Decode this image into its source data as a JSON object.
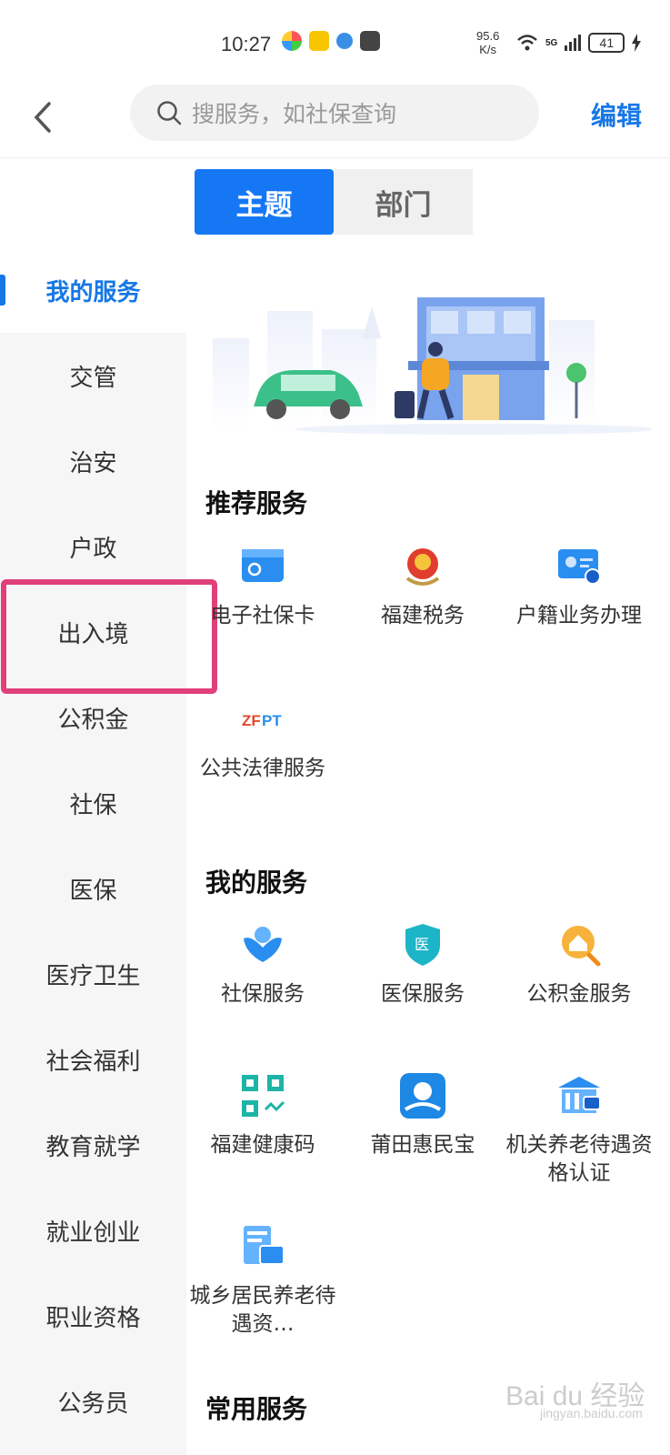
{
  "status_bar": {
    "time": "10:27",
    "net_speed_top": "95.6",
    "net_speed_bottom": "K/s",
    "network": "5G",
    "battery": "41"
  },
  "header": {
    "search_placeholder": "搜服务，如社保查询",
    "edit_label": "编辑"
  },
  "tabs": [
    {
      "label": "主题"
    },
    {
      "label": "部门"
    }
  ],
  "sidebar": {
    "items": [
      {
        "label": "我的服务"
      },
      {
        "label": "交管"
      },
      {
        "label": "治安"
      },
      {
        "label": "户政"
      },
      {
        "label": "出入境"
      },
      {
        "label": "公积金"
      },
      {
        "label": "社保"
      },
      {
        "label": "医保"
      },
      {
        "label": "医疗卫生"
      },
      {
        "label": "社会福利"
      },
      {
        "label": "教育就学"
      },
      {
        "label": "就业创业"
      },
      {
        "label": "职业资格"
      },
      {
        "label": "公务员"
      }
    ]
  },
  "recommended": {
    "title": "推荐服务",
    "items": [
      {
        "label": "电子社保卡",
        "icon": "social-security-card-icon"
      },
      {
        "label": "福建税务",
        "icon": "tax-emblem-icon"
      },
      {
        "label": "户籍业务办理",
        "icon": "household-registration-icon"
      },
      {
        "label": "公共法律服务",
        "icon": "zfpt-legal-service-icon"
      }
    ]
  },
  "my_services": {
    "title": "我的服务",
    "items": [
      {
        "label": "社保服务",
        "icon": "social-security-hands-icon"
      },
      {
        "label": "医保服务",
        "icon": "medical-insurance-shield-icon"
      },
      {
        "label": "公积金服务",
        "icon": "housing-fund-icon"
      },
      {
        "label": "福建健康码",
        "icon": "health-code-icon"
      },
      {
        "label": "莆田惠民宝",
        "icon": "putian-huiminbao-icon"
      },
      {
        "label": "机关养老待遇资格认证",
        "icon": "pension-building-icon"
      },
      {
        "label": "城乡居民养老待遇资…",
        "icon": "resident-pension-icon"
      }
    ]
  },
  "common_services": {
    "title": "常用服务"
  },
  "watermark": {
    "text": "Bai du 经验",
    "sub": "jingyan.baidu.com"
  },
  "colors": {
    "accent": "#1677e6",
    "highlight": "#e0407a",
    "sidebar_bg": "#f6f6f6"
  }
}
